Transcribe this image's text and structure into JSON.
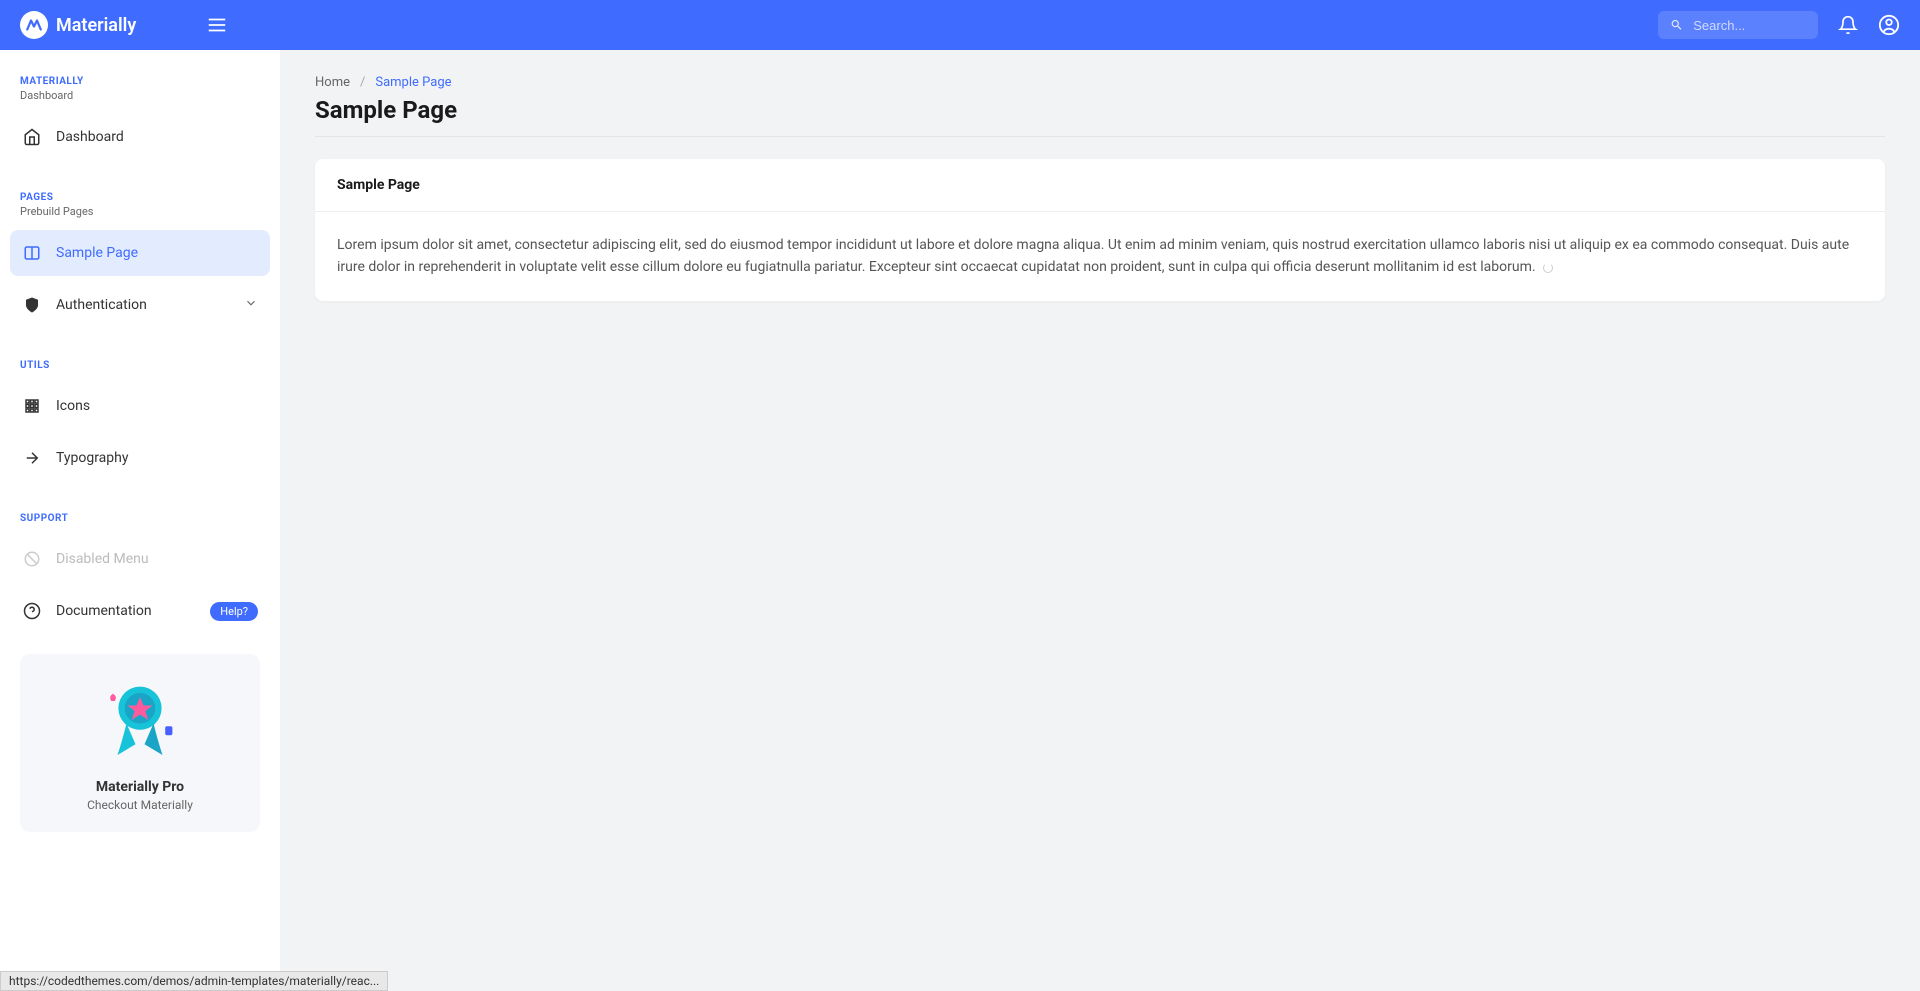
{
  "header": {
    "brand": "Materially",
    "search_placeholder": "Search..."
  },
  "sidebar": {
    "sections": {
      "materially": {
        "title": "MATERIALLY",
        "subtitle": "Dashboard"
      },
      "pages": {
        "title": "PAGES",
        "subtitle": "Prebuild Pages"
      },
      "utils": {
        "title": "UTILS"
      },
      "support": {
        "title": "SUPPORT"
      }
    },
    "items": {
      "dashboard": "Dashboard",
      "sample_page": "Sample Page",
      "authentication": "Authentication",
      "icons": "Icons",
      "typography": "Typography",
      "disabled_menu": "Disabled Menu",
      "documentation": "Documentation"
    },
    "chip_help": "Help?",
    "promo": {
      "title": "Materially Pro",
      "subtitle": "Checkout Materially"
    }
  },
  "breadcrumb": {
    "home": "Home",
    "current": "Sample Page"
  },
  "page": {
    "title": "Sample Page"
  },
  "card": {
    "title": "Sample Page",
    "body": "Lorem ipsum dolor sit amet, consectetur adipiscing elit, sed do eiusmod tempor incididunt ut labore et dolore magna aliqua. Ut enim ad minim veniam, quis nostrud exercitation ullamco laboris nisi ut aliquip ex ea commodo consequat. Duis aute irure dolor in reprehenderit in voluptate velit esse cillum dolore eu fugiatnulla pariatur. Excepteur sint occaecat cupidatat non proident, sunt in culpa qui officia deserunt mollitanim id est laborum."
  },
  "status_bar": "https://codedthemes.com/demos/admin-templates/materially/reac..."
}
